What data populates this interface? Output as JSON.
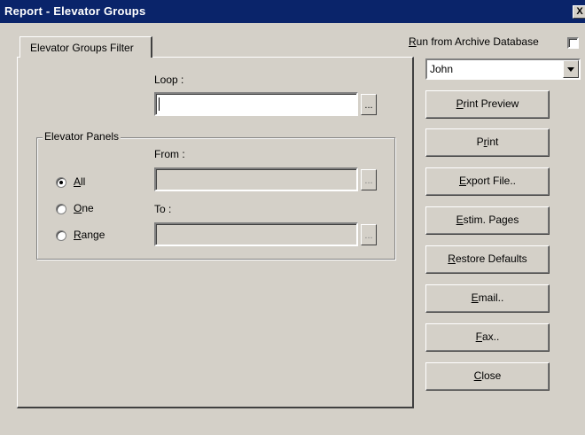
{
  "window": {
    "title": "Report  - Elevator Groups",
    "close_glyph": "X"
  },
  "tabs": [
    {
      "label": "Elevator Groups Filter",
      "selected": true
    }
  ],
  "filter": {
    "loop_label": "Loop :",
    "loop_value": "",
    "loop_browse": "...",
    "panels_group_label": "Elevator Panels",
    "from_label": "From :",
    "from_value": "",
    "from_browse": "...",
    "to_label": "To :",
    "to_value": "",
    "to_browse": "...",
    "radios": [
      {
        "label": "All",
        "mnemonic": "A",
        "rest": "ll",
        "checked": true
      },
      {
        "label": "One",
        "mnemonic": "O",
        "rest": "ne",
        "checked": false
      },
      {
        "label": "Range",
        "mnemonic": "R",
        "rest": "ange",
        "checked": false
      }
    ]
  },
  "archive": {
    "label": "Run from Archive Database",
    "mnemonic": "R",
    "rest": "un from Archive Database",
    "checked": false
  },
  "user_select": {
    "value": "John"
  },
  "buttons": [
    {
      "label": "Print Preview",
      "pre": "",
      "mnemonic": "P",
      "post": "rint Preview"
    },
    {
      "label": "Print",
      "pre": "P",
      "mnemonic": "r",
      "post": "int"
    },
    {
      "label": "Export File..",
      "pre": "",
      "mnemonic": "E",
      "post": "xport File.."
    },
    {
      "label": "Estim. Pages",
      "pre": "",
      "mnemonic": "E",
      "post": "stim. Pages"
    },
    {
      "label": "Restore Defaults",
      "pre": "",
      "mnemonic": "R",
      "post": "estore Defaults"
    },
    {
      "label": "Email..",
      "pre": "",
      "mnemonic": "E",
      "post": "mail.."
    },
    {
      "label": "Fax..",
      "pre": "",
      "mnemonic": "F",
      "post": "ax.."
    },
    {
      "label": "Close",
      "pre": "",
      "mnemonic": "C",
      "post": "lose"
    }
  ],
  "colors": {
    "titlebar": "#0a246a",
    "face": "#d4d0c8"
  }
}
